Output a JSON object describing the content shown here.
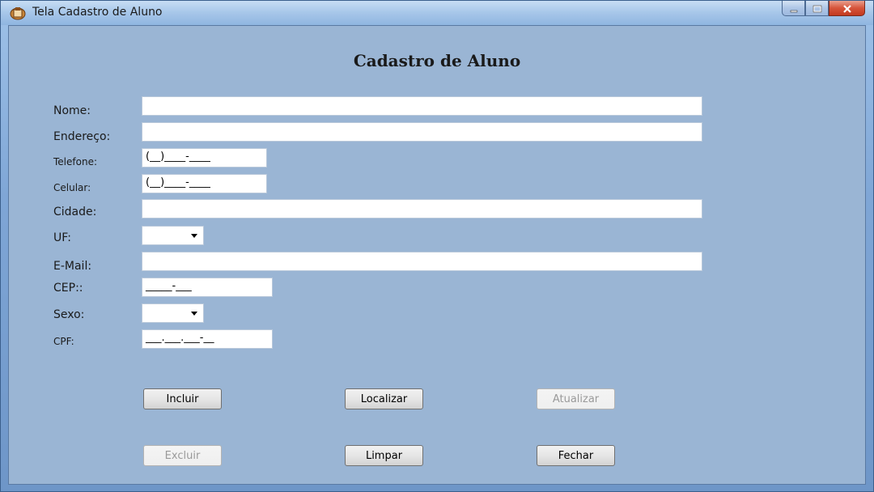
{
  "window": {
    "title": "Tela Cadastro de Aluno",
    "caption": {
      "minimize": "minimize-icon",
      "maximize": "maximize-icon",
      "close": "close-icon"
    }
  },
  "form": {
    "title": "Cadastro de Aluno",
    "fields": {
      "nome": {
        "label": "Nome:",
        "value": ""
      },
      "endereco": {
        "label": "Endereço:",
        "value": ""
      },
      "telefone": {
        "label": "Telefone:",
        "value": "(__)____-____"
      },
      "celular": {
        "label": "Celular:",
        "value": "(__)____-____"
      },
      "cidade": {
        "label": "Cidade:",
        "value": ""
      },
      "uf": {
        "label": "UF:",
        "value": ""
      },
      "email": {
        "label": "E-Mail:",
        "value": ""
      },
      "cep": {
        "label": "CEP::",
        "value": "_____-___"
      },
      "sexo": {
        "label": "Sexo:",
        "value": ""
      },
      "cpf": {
        "label": "CPF:",
        "value": "___.___.___-__"
      }
    },
    "buttons": {
      "incluir": "Incluir",
      "localizar": "Localizar",
      "atualizar": "Atualizar",
      "excluir": "Excluir",
      "limpar": "Limpar",
      "fechar": "Fechar"
    }
  },
  "colors": {
    "panel": "#9ab5d4",
    "close_button": "#c23a20",
    "disabled_text": "#9a9a9a"
  }
}
